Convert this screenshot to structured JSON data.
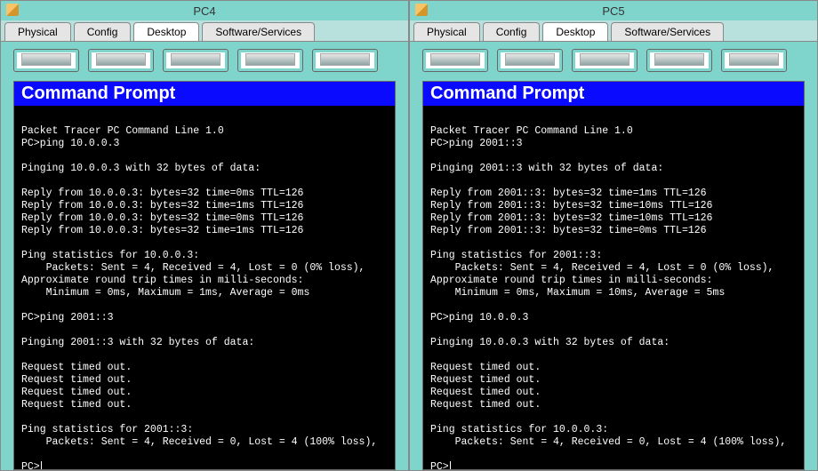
{
  "windows": [
    {
      "title": "PC4",
      "tabs": [
        "Physical",
        "Config",
        "Desktop",
        "Software/Services"
      ],
      "active_tab": "Desktop",
      "cmd_title": "Command Prompt",
      "terminal_lines": [
        "",
        "Packet Tracer PC Command Line 1.0",
        "PC>ping 10.0.0.3",
        "",
        "Pinging 10.0.0.3 with 32 bytes of data:",
        "",
        "Reply from 10.0.0.3: bytes=32 time=0ms TTL=126",
        "Reply from 10.0.0.3: bytes=32 time=1ms TTL=126",
        "Reply from 10.0.0.3: bytes=32 time=0ms TTL=126",
        "Reply from 10.0.0.3: bytes=32 time=1ms TTL=126",
        "",
        "Ping statistics for 10.0.0.3:",
        "    Packets: Sent = 4, Received = 4, Lost = 0 (0% loss),",
        "Approximate round trip times in milli-seconds:",
        "    Minimum = 0ms, Maximum = 1ms, Average = 0ms",
        "",
        "PC>ping 2001::3",
        "",
        "Pinging 2001::3 with 32 bytes of data:",
        "",
        "Request timed out.",
        "Request timed out.",
        "Request timed out.",
        "Request timed out.",
        "",
        "Ping statistics for 2001::3:",
        "    Packets: Sent = 4, Received = 0, Lost = 4 (100% loss),",
        "",
        "PC>"
      ]
    },
    {
      "title": "PC5",
      "tabs": [
        "Physical",
        "Config",
        "Desktop",
        "Software/Services"
      ],
      "active_tab": "Desktop",
      "cmd_title": "Command Prompt",
      "terminal_lines": [
        "",
        "Packet Tracer PC Command Line 1.0",
        "PC>ping 2001::3",
        "",
        "Pinging 2001::3 with 32 bytes of data:",
        "",
        "Reply from 2001::3: bytes=32 time=1ms TTL=126",
        "Reply from 2001::3: bytes=32 time=10ms TTL=126",
        "Reply from 2001::3: bytes=32 time=10ms TTL=126",
        "Reply from 2001::3: bytes=32 time=0ms TTL=126",
        "",
        "Ping statistics for 2001::3:",
        "    Packets: Sent = 4, Received = 4, Lost = 0 (0% loss),",
        "Approximate round trip times in milli-seconds:",
        "    Minimum = 0ms, Maximum = 10ms, Average = 5ms",
        "",
        "PC>ping 10.0.0.3",
        "",
        "Pinging 10.0.0.3 with 32 bytes of data:",
        "",
        "Request timed out.",
        "Request timed out.",
        "Request timed out.",
        "Request timed out.",
        "",
        "Ping statistics for 10.0.0.3:",
        "    Packets: Sent = 4, Received = 0, Lost = 4 (100% loss),",
        "",
        "PC>"
      ]
    }
  ]
}
